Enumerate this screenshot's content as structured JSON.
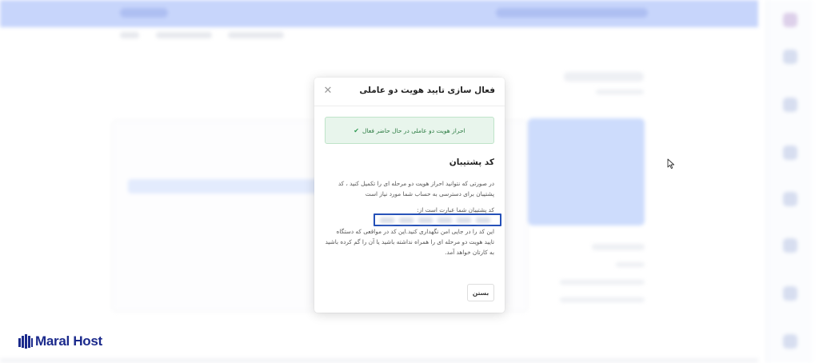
{
  "modal": {
    "title": "فعال سازی تایید هویت دو عاملی",
    "close_icon": "close-icon",
    "alert_text": "احراز هویت دو عاملی در حال حاضر فعال",
    "alert_icon": "check-icon",
    "section_title": "کد پشتیبان",
    "description": "در صورتی که نتوانید احراز هویت دو مرحله ای را تکمیل کنید ، کد پشتیبان برای دسترسی به حساب شما مورد نیاز است",
    "code_label": "کد پشتیبان شما عبارت است از:",
    "code_note": "این کد را در جایی امن نگهداری کنید.این کد در مواقعی که دستگاه تایید هویت دو مرحله ای را همراه نداشته باشید یا آن را گم کرده باشید به کارتان خواهد آمد.",
    "close_button_label": "بستن"
  },
  "brand": {
    "logo_text": "Maral Host",
    "logo_color": "#1b2a8c"
  },
  "colors": {
    "topbar": "#c7d5fb",
    "success_bg": "#e8f5ec",
    "success_text": "#2e7d44",
    "highlight_border": "#2450b8"
  }
}
